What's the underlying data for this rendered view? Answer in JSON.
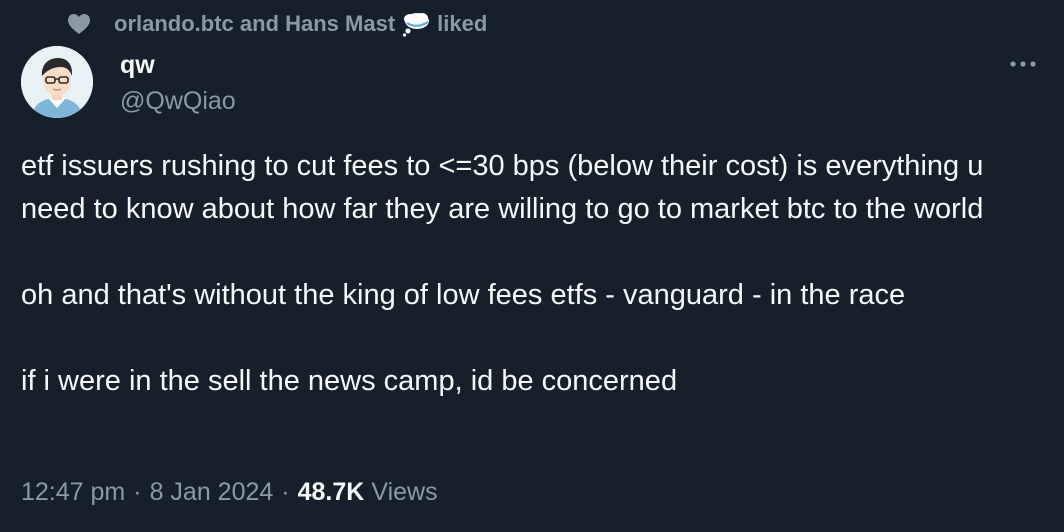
{
  "social_context": {
    "icon": "heart-icon",
    "users_text": "orlando.btc and Hans Mast",
    "badge_icon": "thought-cloud-icon",
    "action": "liked"
  },
  "author": {
    "name": "qw",
    "handle": "@QwQiao",
    "avatar_icon": "cartoon-avatar"
  },
  "tweet": {
    "paragraphs": [
      "etf issuers rushing to cut fees to <=30 bps (below their cost) is everything u need to know about how far they are willing to go to market btc to the world",
      "oh and that's without the king of low fees etfs - vanguard - in the race",
      "if i were in the sell the news camp, id be concerned"
    ]
  },
  "meta": {
    "time": "12:47 pm",
    "separator": "·",
    "date": "8 Jan 2024",
    "views_count": "48.7K",
    "views_label": "Views"
  },
  "colors": {
    "background": "#15202b",
    "primary_text": "#f7f9f9",
    "secondary_text": "#8b98a5"
  }
}
